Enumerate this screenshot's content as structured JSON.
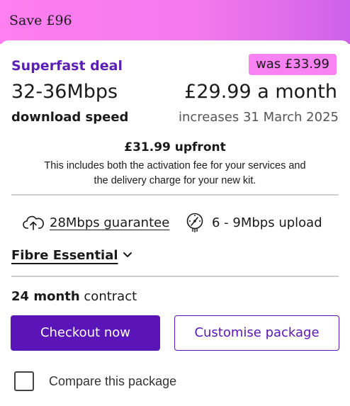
{
  "banner": {
    "text": "Save £96"
  },
  "deal": {
    "title": "Superfast deal",
    "was_price": "was £33.99",
    "speed": "32-36Mbps",
    "speed_sub": "download speed",
    "price": "£29.99 a month",
    "increase": "increases 31 March 2025",
    "upfront": "£31.99 upfront",
    "upfront_desc": "This includes both the activation fee for your services and the delivery charge for your new kit."
  },
  "features": {
    "guarantee": {
      "icon": "cloud-upload-icon",
      "label": "28Mbps guarantee"
    },
    "upload": {
      "icon": "speedometer-icon",
      "label": "6 - 9Mbps upload"
    }
  },
  "package": {
    "name": "Fibre Essential",
    "icon": "chevron-down-icon"
  },
  "contract": {
    "length": "24 month",
    "suffix": "contract"
  },
  "actions": {
    "checkout": "Checkout now",
    "customise": "Customise package",
    "compare": "Compare this package"
  },
  "colors": {
    "accent": "#5a14b8",
    "banner_start": "#ff7ef0",
    "banner_end": "#cf62ea",
    "badge": "#f882f1"
  }
}
